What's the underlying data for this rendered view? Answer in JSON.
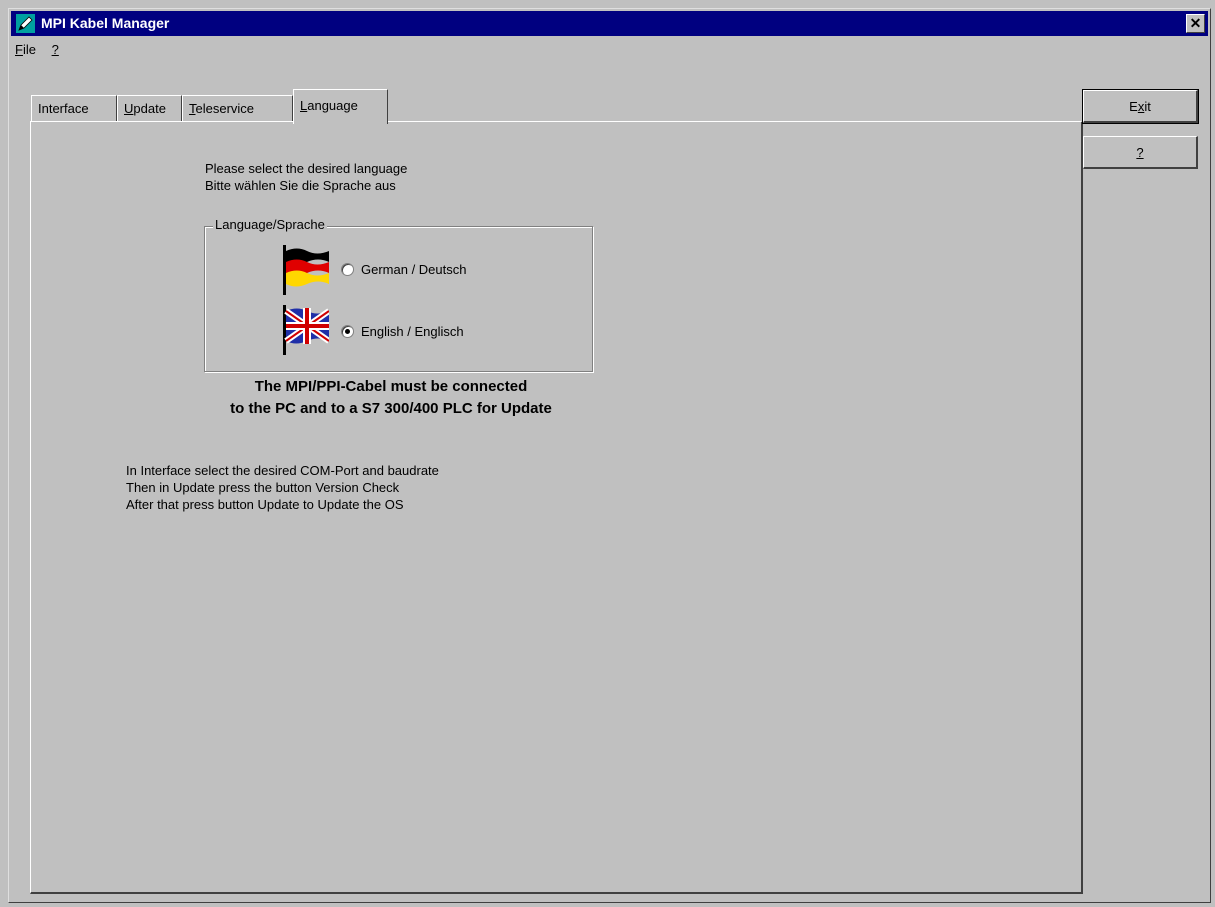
{
  "window": {
    "title": "MPI Kabel Manager",
    "close_label": "✕"
  },
  "menu": {
    "items": [
      {
        "underline": "F",
        "rest": "ile"
      },
      {
        "underline": "?",
        "rest": ""
      }
    ]
  },
  "tabs": [
    {
      "pre": "Interface",
      "u": "",
      "post": ""
    },
    {
      "pre": "",
      "u": "U",
      "post": "pdate"
    },
    {
      "pre": "",
      "u": "T",
      "post": "eleservice"
    },
    {
      "pre": "",
      "u": "L",
      "post": "anguage"
    }
  ],
  "active_tab": "Language",
  "buttons": {
    "exit": {
      "pre": "E",
      "u": "x",
      "post": "it"
    },
    "help": {
      "pre": "",
      "u": "?",
      "post": ""
    }
  },
  "language_page": {
    "prompt_line1": "Please select the desired language",
    "prompt_line2": "Bitte wählen Sie die Sprache aus",
    "group_label": "Language/Sprache",
    "options": [
      {
        "label": "German / Deutsch",
        "checked": false,
        "flag": "german-flag-icon"
      },
      {
        "label": "English / Englisch",
        "checked": true,
        "flag": "uk-flag-icon"
      }
    ],
    "notice_line1": "The MPI/PPI-Cabel must be connected",
    "notice_line2": "to the PC and to a S7 300/400 PLC for Update",
    "instructions": [
      "In Interface select the desired COM-Port and baudrate",
      "Then in Update press the button Version Check",
      "After that press button Update to Update the OS"
    ]
  },
  "colors": {
    "titlebar": "#000080",
    "face": "#c0c0c0"
  }
}
